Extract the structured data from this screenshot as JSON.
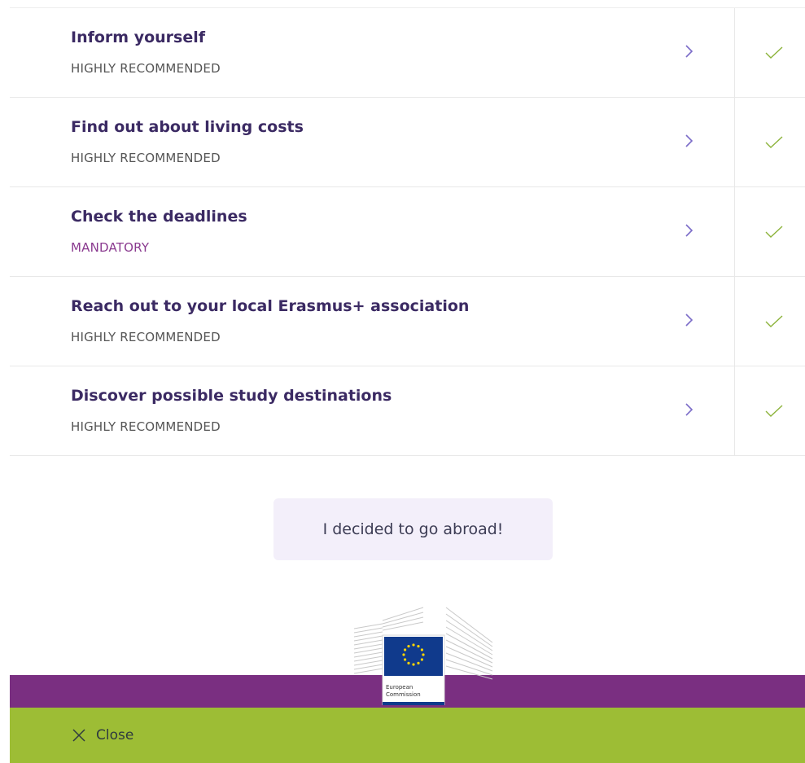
{
  "steps": [
    {
      "title": "Inform yourself",
      "level": "HIGHLY RECOMMENDED"
    },
    {
      "title": "Find out about living costs",
      "level": "HIGHLY RECOMMENDED"
    },
    {
      "title": "Check the deadlines",
      "level": "MANDATORY"
    },
    {
      "title": "Reach out to your local Erasmus+ association",
      "level": "HIGHLY RECOMMENDED"
    },
    {
      "title": "Discover possible study destinations",
      "level": "HIGHLY RECOMMENDED"
    }
  ],
  "cta_label": "I decided to go abroad!",
  "logo": {
    "line1": "European",
    "line2": "Commission"
  },
  "footer": {
    "close_label": "Close"
  },
  "colors": {
    "title": "#3b2a63",
    "mandatory": "#8a3a8f",
    "chevron": "#7b6cc8",
    "check": "#8cb33a",
    "purple_bar": "#7a2f81",
    "green_bar": "#9dbd35",
    "cta_bg": "#f3effa"
  },
  "icons": {
    "chevron": "chevron-right-icon",
    "check": "checkmark-icon",
    "close": "close-icon"
  }
}
